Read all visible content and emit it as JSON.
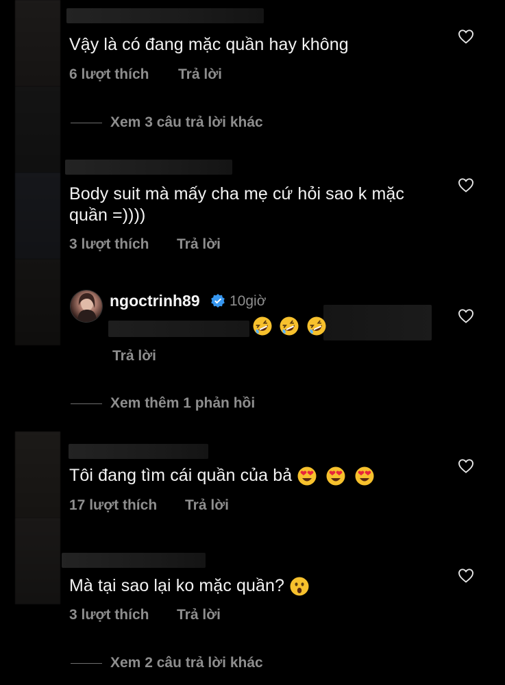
{
  "comments": [
    {
      "text": "Vậy là có đang mặc quần hay không",
      "likes": "6 lượt thích",
      "reply": "Trả lời",
      "view_more": "Xem 3 câu trả lời khác"
    },
    {
      "text_line1": "Body suit mà mấy cha mẹ cứ hỏi sao k mặc",
      "text_line2": "quần =))))",
      "likes": "3 lượt thích",
      "reply": "Trả lời"
    },
    {
      "username": "ngoctrinh89",
      "time": "10giờ",
      "reply": "Trả lời",
      "view_more": "Xem thêm 1 phản hồi",
      "emojis": [
        "rofl",
        "rofl",
        "rofl"
      ]
    },
    {
      "text": "Tôi đang tìm cái quần của bả",
      "likes": "17 lượt thích",
      "reply": "Trả lời",
      "emojis": [
        "heart-eyes",
        "heart-eyes",
        "heart-eyes"
      ]
    },
    {
      "text": "Mà tại sao lại ko mặc quần?",
      "likes": "3 lượt thích",
      "reply": "Trả lời",
      "view_more": "Xem 2 câu trả lời khác",
      "emojis": [
        "astonished"
      ]
    }
  ],
  "icons": {
    "like": "heart-outline-icon",
    "verified": "verified-badge-icon"
  },
  "colors": {
    "background": "#000000",
    "text": "#f3f3f3",
    "secondary": "#8e8e8e",
    "verified": "#3797f0"
  }
}
